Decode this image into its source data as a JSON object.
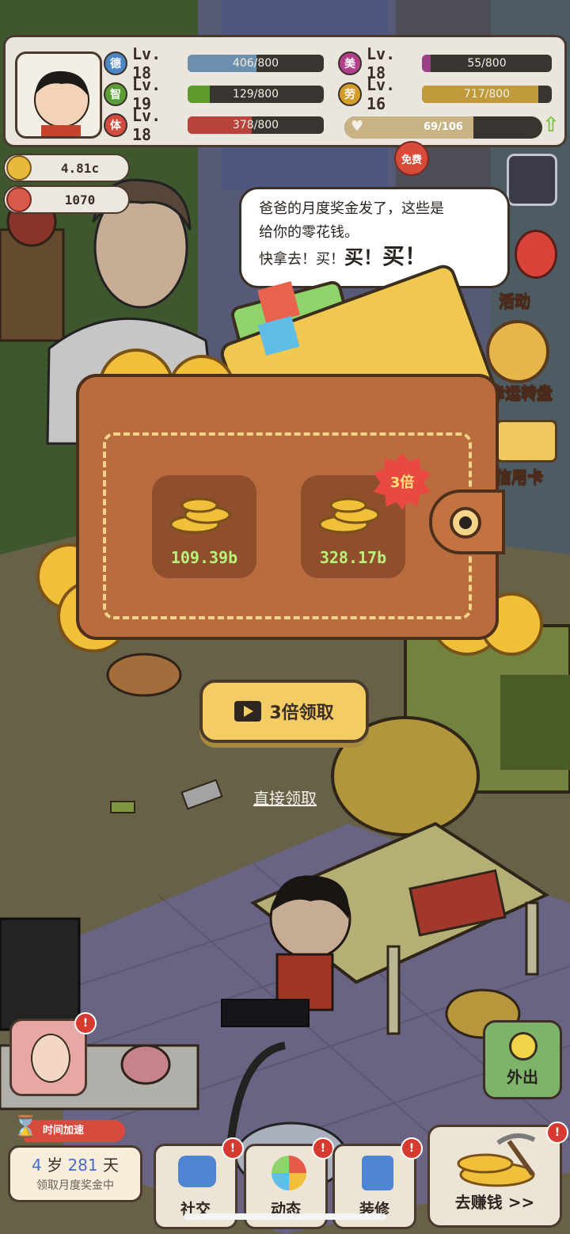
{
  "stats": {
    "rows": [
      {
        "icon_char": "德",
        "level": "Lv. 18",
        "progress": "406/800",
        "fill": 0.5075,
        "color": "#4d86c4",
        "bar_color": "#6c8fae"
      },
      {
        "icon_char": "智",
        "level": "Lv. 19",
        "progress": "129/800",
        "fill": 0.16,
        "color": "#5a9d36",
        "bar_color": "#5f9a2c"
      },
      {
        "icon_char": "体",
        "level": "Lv. 18",
        "progress": "378/800",
        "fill": 0.4725,
        "color": "#d14c3e",
        "bar_color": "#b8433b"
      },
      {
        "icon_char": "美",
        "level": "Lv. 18",
        "progress": "55/800",
        "fill": 0.07,
        "color": "#b0408c",
        "bar_color": "#9c3f89"
      },
      {
        "icon_char": "劳",
        "level": "Lv. 16",
        "progress": "717/800",
        "fill": 0.896,
        "color": "#d39b2a",
        "bar_color": "#c09a3a"
      }
    ],
    "happiness": {
      "progress": "69/106",
      "fill": 0.65
    }
  },
  "currency": {
    "coins": "4.81c",
    "gems": "1070"
  },
  "speech": {
    "line1": "爸爸的月度奖金发了，这些是",
    "line2": "给你的零花钱。",
    "line3a": "快拿去！买！",
    "line3b": "买！",
    "line3c": "买！"
  },
  "side_menu": {
    "activity": "活动",
    "lucky_wheel": "幸运转盘",
    "credit_card": "信用卡",
    "free_tag": "免费"
  },
  "reward": {
    "normal_value": "109.39b",
    "triple_value": "328.17b",
    "triple_badge": "3倍"
  },
  "buttons": {
    "claim_triple": "3倍领取",
    "claim_direct": "直接领取",
    "go_out": "外出"
  },
  "age": {
    "years": "4",
    "years_unit": "岁",
    "days": "281",
    "days_unit": "天",
    "status": "领取月度奖金中"
  },
  "time_accel": "时间加速",
  "nav": {
    "social": "社交",
    "feed": "动态",
    "decorate": "装修",
    "earn": "去赚钱 >>"
  },
  "alerts": {
    "mark": "!"
  }
}
